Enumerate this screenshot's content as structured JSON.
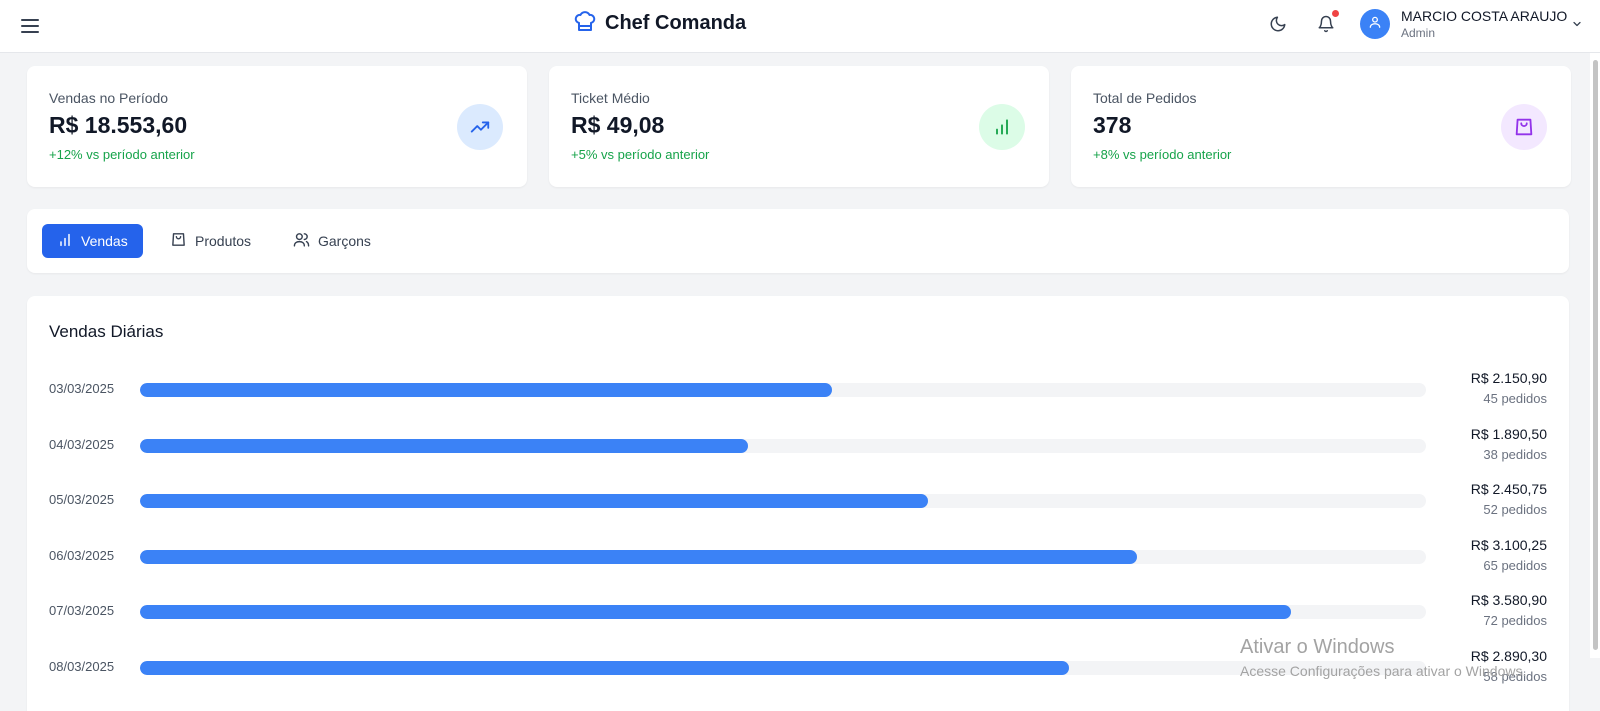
{
  "app": {
    "title": "Chef Comanda",
    "user_name": "MARCIO COSTA ARAUJO",
    "user_role": "Admin",
    "has_notifications": true,
    "icons": {
      "menu": "hamburger-icon",
      "logo": "chef-hat-icon",
      "theme": "moon-icon",
      "notifications": "bell-icon",
      "user": "user-icon",
      "dropdown": "chevron-down-icon"
    }
  },
  "stats": [
    {
      "label": "Vendas no Período",
      "value": "R$ 18.553,60",
      "change": "+12% vs período anterior",
      "icon": "trending-up-icon",
      "color": "#2563eb"
    },
    {
      "label": "Ticket Médio",
      "value": "R$ 49,08",
      "change": "+5% vs período anterior",
      "icon": "bar-chart-icon",
      "color": "#16a34a"
    },
    {
      "label": "Total de Pedidos",
      "value": "378",
      "change": "+8% vs período anterior",
      "icon": "shopping-bag-icon",
      "color": "#9333ea"
    }
  ],
  "tabs": [
    {
      "label": "Vendas",
      "icon": "bar-chart-icon",
      "active": true
    },
    {
      "label": "Produtos",
      "icon": "shopping-bag-icon",
      "active": false
    },
    {
      "label": "Garçons",
      "icon": "users-icon",
      "active": false
    }
  ],
  "chart": {
    "title": "Vendas Diárias",
    "rows": [
      {
        "date": "03/03/2025",
        "amount": "R$ 2.150,90",
        "count": "45 pedidos"
      },
      {
        "date": "04/03/2025",
        "amount": "R$ 1.890,50",
        "count": "38 pedidos"
      },
      {
        "date": "05/03/2025",
        "amount": "R$ 2.450,75",
        "count": "52 pedidos"
      },
      {
        "date": "06/03/2025",
        "amount": "R$ 3.100,25",
        "count": "65 pedidos"
      },
      {
        "date": "07/03/2025",
        "amount": "R$ 3.580,90",
        "count": "72 pedidos"
      },
      {
        "date": "08/03/2025",
        "amount": "R$ 2.890,30",
        "count": "58 pedidos"
      }
    ]
  },
  "chart_data": {
    "type": "bar",
    "title": "Vendas Diárias",
    "categories": [
      "03/03/2025",
      "04/03/2025",
      "05/03/2025",
      "06/03/2025",
      "07/03/2025",
      "08/03/2025"
    ],
    "values": [
      2150.9,
      1890.5,
      2450.75,
      3100.25,
      3580.9,
      2890.3
    ],
    "orders": [
      45,
      38,
      52,
      65,
      72,
      58
    ],
    "xlim": [
      0,
      4000
    ],
    "orientation": "horizontal",
    "bar_color": "#3b82f6"
  },
  "watermark": {
    "title": "Ativar o Windows",
    "subtitle": "Acesse Configurações para ativar o Windows."
  }
}
